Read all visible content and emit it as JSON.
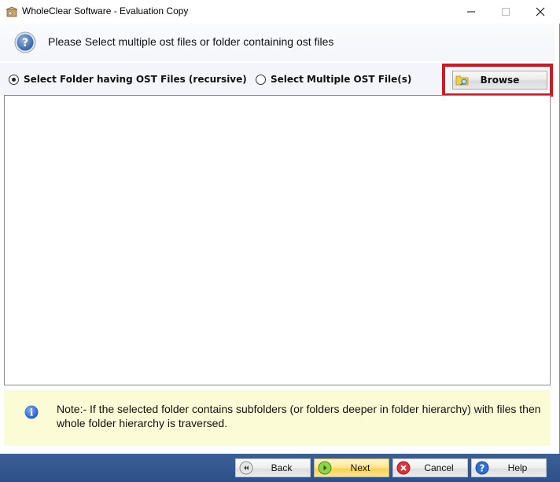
{
  "window": {
    "title": "WholeClear Software - Evaluation Copy",
    "controls": {
      "minimize": "minimize",
      "maximize": "maximize",
      "close": "close"
    }
  },
  "header": {
    "icon": "question-circle-icon",
    "text": "Please Select multiple ost files or folder containing ost files"
  },
  "options": {
    "selected": "folder",
    "radio_folder_label": "Select Folder having OST Files (recursive)",
    "radio_files_label": "Select Multiple OST File(s)",
    "browse_label": "Browse",
    "highlight_color": "#e3101c"
  },
  "file_list": {
    "items": []
  },
  "note": {
    "icon": "info-icon",
    "text": "Note:- If the selected folder contains subfolders (or folders deeper in folder hierarchy) with files then whole folder hierarchy is traversed."
  },
  "footer": {
    "back_label": "Back",
    "next_label": "Next",
    "cancel_label": "Cancel",
    "help_label": "Help"
  }
}
